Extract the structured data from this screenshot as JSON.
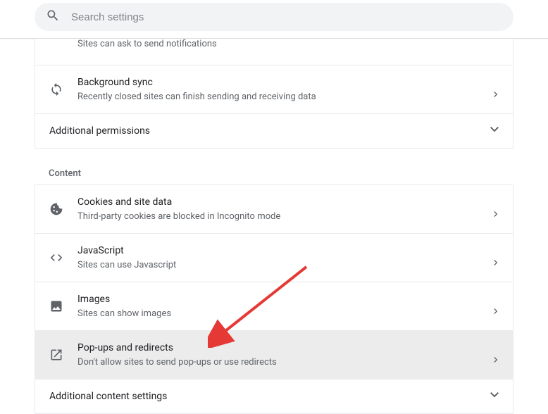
{
  "search": {
    "placeholder": "Search settings"
  },
  "partial_row": {
    "subtitle": "Sites can ask to send notifications"
  },
  "rows": {
    "background_sync": {
      "title": "Background sync",
      "subtitle": "Recently closed sites can finish sending and receiving data"
    },
    "cookies": {
      "title": "Cookies and site data",
      "subtitle": "Third-party cookies are blocked in Incognito mode"
    },
    "javascript": {
      "title": "JavaScript",
      "subtitle": "Sites can use Javascript"
    },
    "images": {
      "title": "Images",
      "subtitle": "Sites can show images"
    },
    "popups": {
      "title": "Pop-ups and redirects",
      "subtitle": "Don't allow sites to send pop-ups or use redirects"
    }
  },
  "sections": {
    "additional_permissions": "Additional permissions",
    "content_header": "Content",
    "additional_content": "Additional content settings"
  }
}
